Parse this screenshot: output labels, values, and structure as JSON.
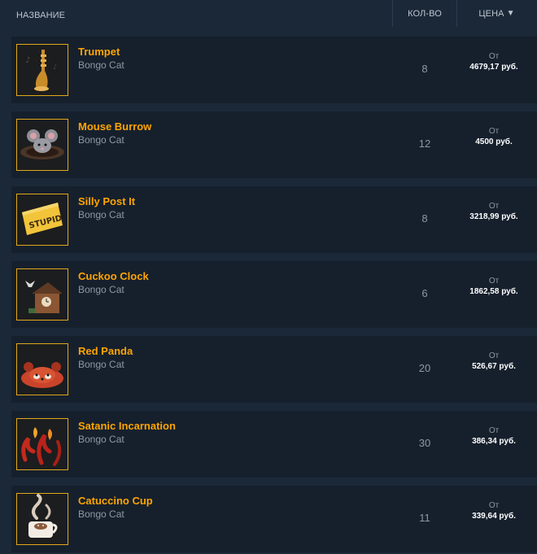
{
  "header": {
    "name_label": "НАЗВАНИЕ",
    "qty_label": "КОЛ-ВО",
    "price_label": "ЦЕНА",
    "sort_icon": "▼"
  },
  "items": [
    {
      "title": "Trumpet",
      "game": "Bongo Cat",
      "qty": "8",
      "from": "От",
      "price": "4679,17 руб.",
      "icon": "trumpet-icon"
    },
    {
      "title": "Mouse Burrow",
      "game": "Bongo Cat",
      "qty": "12",
      "from": "От",
      "price": "4500 руб.",
      "icon": "mouse-burrow-icon"
    },
    {
      "title": "Silly Post It",
      "game": "Bongo Cat",
      "qty": "8",
      "from": "От",
      "price": "3218,99 руб.",
      "icon": "post-it-icon",
      "icon_text": "STUPID"
    },
    {
      "title": "Cuckoo Clock",
      "game": "Bongo Cat",
      "qty": "6",
      "from": "От",
      "price": "1862,58 руб.",
      "icon": "cuckoo-clock-icon"
    },
    {
      "title": "Red Panda",
      "game": "Bongo Cat",
      "qty": "20",
      "from": "От",
      "price": "526,67 руб.",
      "icon": "red-panda-icon"
    },
    {
      "title": "Satanic Incarnation",
      "game": "Bongo Cat",
      "qty": "30",
      "from": "От",
      "price": "386,34 руб.",
      "icon": "satanic-incarnation-icon"
    },
    {
      "title": "Catuccino Cup",
      "game": "Bongo Cat",
      "qty": "11",
      "from": "От",
      "price": "339,64 руб.",
      "icon": "coffee-cup-icon"
    }
  ],
  "colors": {
    "background": "#1b2838",
    "row_background": "#16202d",
    "title": "#ffa500",
    "thumb_border": "#e1a81a",
    "muted_text": "#8f98a0"
  }
}
